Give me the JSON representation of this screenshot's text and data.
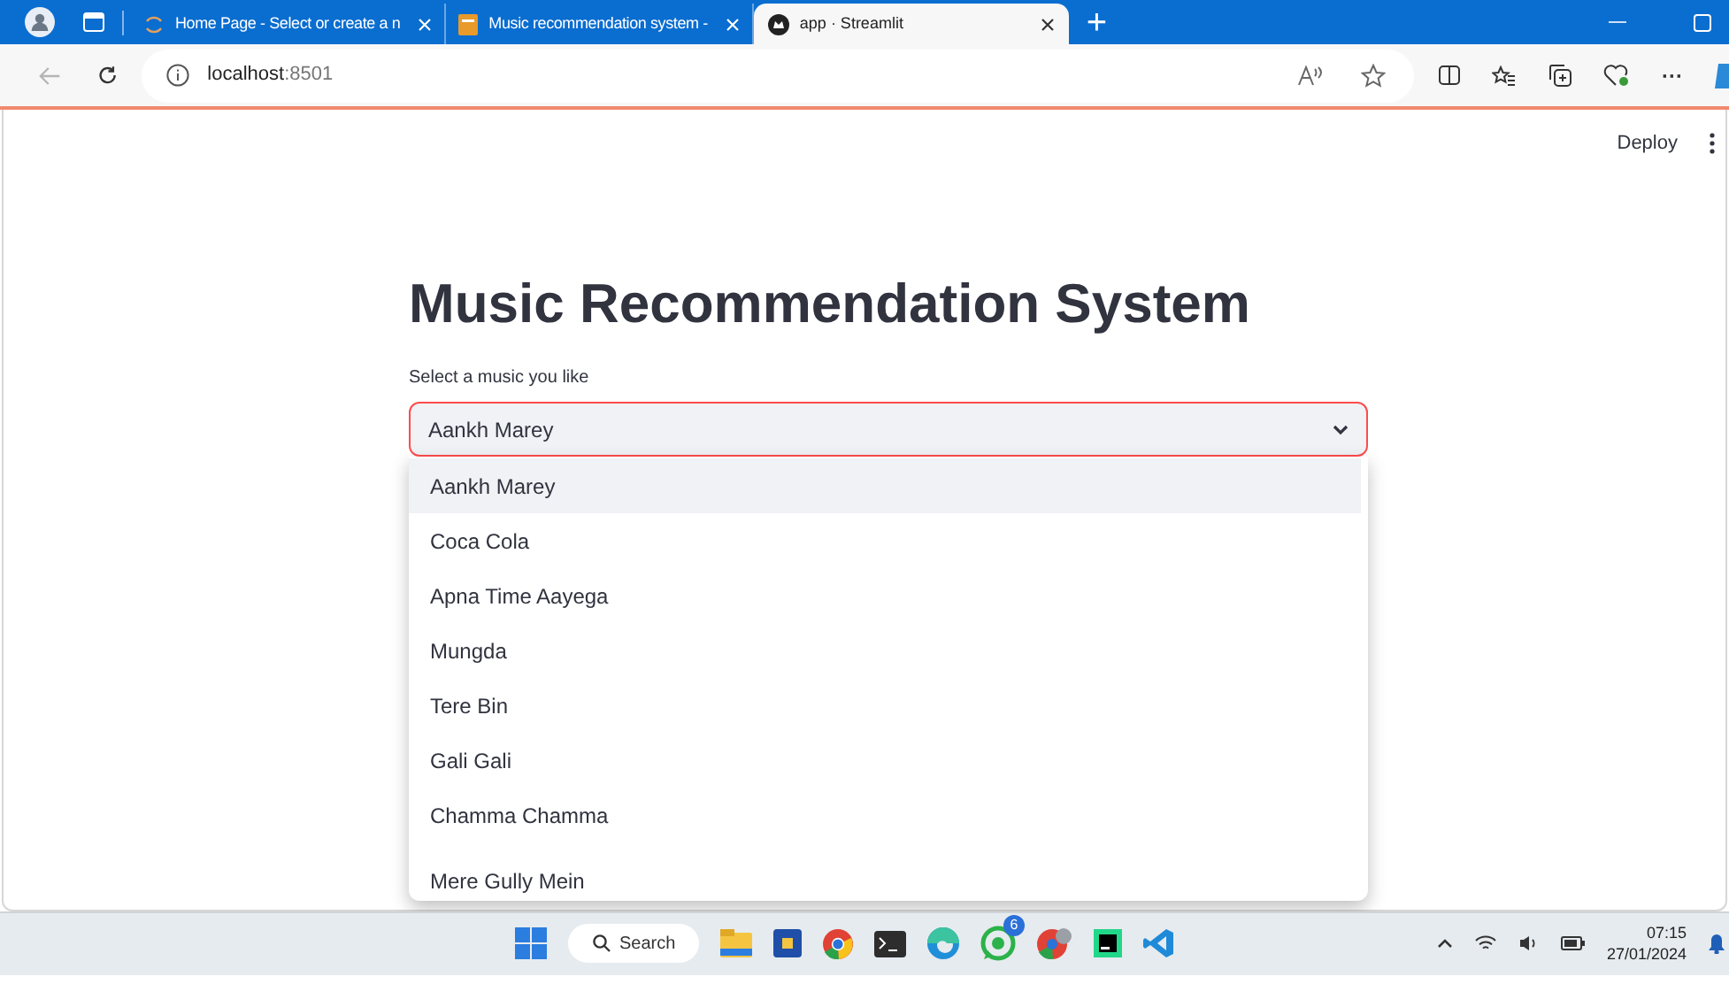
{
  "browser": {
    "tabs": [
      {
        "title": "Home Page - Select or create a n",
        "kind": "spinner",
        "selected": false
      },
      {
        "title": "Music recommendation system -",
        "kind": "book",
        "selected": false
      },
      {
        "title": "app · Streamlit",
        "kind": "streamlit",
        "selected": true
      }
    ],
    "new_tab": "+",
    "more_menu": "···",
    "address": {
      "host": "localhost",
      "port": ":8501"
    }
  },
  "app": {
    "deploy": "Deploy",
    "title": "Music Recommendation System",
    "select": {
      "label": "Select a music you like",
      "value": "Aankh Marey",
      "focused": true,
      "options": [
        {
          "label": "Aankh Marey",
          "selected": true
        },
        {
          "label": "Coca Cola",
          "selected": false
        },
        {
          "label": "Apna Time Aayega",
          "selected": false
        },
        {
          "label": "Mungda",
          "selected": false
        },
        {
          "label": "Tere Bin",
          "selected": false
        },
        {
          "label": "Gali Gali",
          "selected": false
        },
        {
          "label": "Chamma Chamma",
          "selected": false
        },
        {
          "label": "Mere Gully Mein",
          "selected": false
        }
      ]
    }
  },
  "taskbar": {
    "search": "Search",
    "whatsapp_badge": "6",
    "time": "07:15",
    "date": "27/01/2024"
  }
}
